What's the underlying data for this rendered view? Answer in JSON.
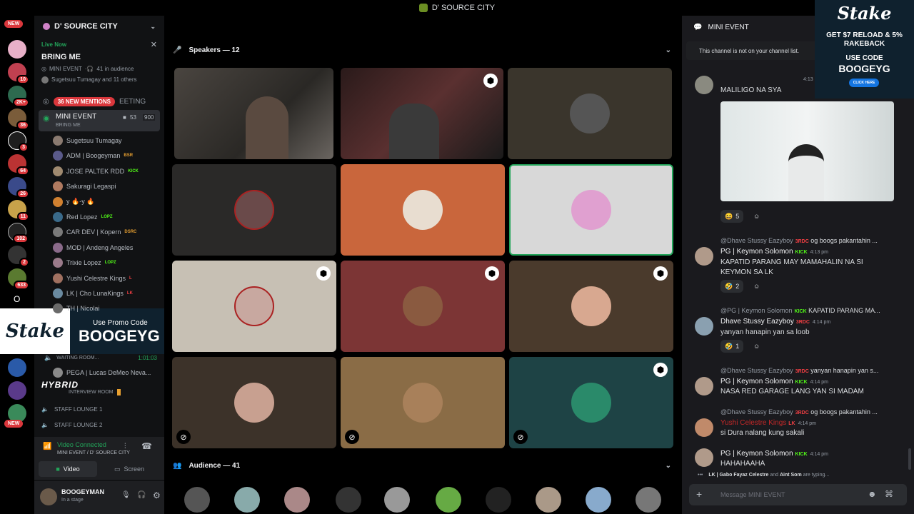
{
  "window": {
    "title": "D' SOURCE CITY"
  },
  "server_rail": {
    "new_top": "NEW",
    "new_bottom": "NEW",
    "badges": [
      "10",
      "2K+",
      "36",
      "3",
      "64",
      "26",
      "11",
      "102",
      "2",
      "633"
    ],
    "letter_o": "O"
  },
  "sidebar": {
    "server_name": "D' SOURCE CITY",
    "live": {
      "label": "Live Now",
      "title": "BRING ME",
      "meta1": "MINI EVENT",
      "meta2": "41 in audience",
      "meta3": "Sugetsuu Tumagay and 11 others"
    },
    "mentions": "36 NEW MENTIONS",
    "hidden_channel": "EETING",
    "active_channel": {
      "name": "MINI EVENT",
      "subtitle": "BRING ME",
      "count1": "53",
      "count2": "900"
    },
    "users": [
      {
        "name": "Sugetsuu Tumagay",
        "tag": ""
      },
      {
        "name": "ADM | Boogeyman",
        "tag": "BSR"
      },
      {
        "name": "JOSE PALTEK RDD",
        "tag": "KICK"
      },
      {
        "name": "Sakuragi Legaspi",
        "tag": ""
      },
      {
        "name": "y 🔥-y 🔥",
        "tag": ""
      },
      {
        "name": "Red Lopez",
        "tag": "LOPZ"
      },
      {
        "name": "CAR DEV | Kopern",
        "tag": "DSRC"
      },
      {
        "name": "MOD | Andeng Angeles",
        "tag": ""
      },
      {
        "name": "Trixie Lopez",
        "tag": "LOPZ"
      },
      {
        "name": "Yushi Celestre Kings",
        "tag": "L"
      },
      {
        "name": "LK | Cho LunaKings",
        "tag": "LK"
      },
      {
        "name": "TH | Nicolai",
        "tag": ""
      }
    ],
    "waiting_room": "WAITING ROOM...",
    "waiting_time": "1:01:03",
    "pega_user": "PEGA | Lucas DeMeo Neva...",
    "interview_room": "INTERVIEW ROOM",
    "staff1": "STAFF LOUNGE 1",
    "staff2": "STAFF LOUNGE 2",
    "voice": {
      "status": "Video Connected",
      "location": "MINI EVENT / D' SOURCE CITY",
      "video_btn": "Video",
      "screen_btn": "Screen"
    },
    "user": {
      "name": "BOOGEYMAN",
      "status": "In a stage"
    }
  },
  "overlay": {
    "brand": "Stake",
    "promo_label": "Use Promo Code",
    "promo_code": "BOOGEYG",
    "hybrid": "HYBRID"
  },
  "stage": {
    "speakers_label": "Speakers — 12",
    "audience_label": "Audience — 41"
  },
  "chat": {
    "channel": "MINI EVENT",
    "notice": "This channel is not on your channel list.",
    "messages": [
      {
        "time": "4:13 pm",
        "text": "MALILIGO NA SYA",
        "reaction_count": "5"
      },
      {
        "reply": "@Dhave Stussy Eazyboy",
        "reply_tag": "3RDC",
        "reply_text": "og boogs pakantahin ...",
        "name": "PG | Keymon Solomon",
        "tag": "KICK",
        "time": "4:13 pm",
        "text1": "KAPATID PARANG MAY MAMAHALIN NA SI",
        "text2": "KEYMON SA LK",
        "reaction_count": "2"
      },
      {
        "reply": "@PG | Keymon Solomon",
        "reply_tag": "KICK",
        "reply_text": "KAPATID PARANG MA...",
        "name": "Dhave Stussy Eazyboy",
        "tag": "3RDC",
        "time": "4:14 pm",
        "text": "yanyan hanapin yan sa loob",
        "reaction_count": "1"
      },
      {
        "reply": "@Dhave Stussy Eazyboy",
        "reply_tag": "3RDC",
        "reply_text": "yanyan hanapin yan s...",
        "name": "PG | Keymon Solomon",
        "tag": "KICK",
        "time": "4:14 pm",
        "text": "NASA RED GARAGE LANG YAN SI MADAM"
      },
      {
        "reply": "@Dhave Stussy Eazyboy",
        "reply_tag": "3RDC",
        "reply_text": "og boogs pakantahin ...",
        "name": "Yushi Celestre Kings",
        "tag": "LK",
        "time": "4:14 pm",
        "text": "si Dura nalang kung sakali"
      },
      {
        "name": "PG | Keymon Solomon",
        "tag": "KICK",
        "time": "4:14 pm",
        "text": "HAHAHAAHA"
      }
    ],
    "typing_users": "LK | Gabo Fayaz Celestre",
    "typing_and": "and",
    "typing_user2": "Aint Som",
    "typing_suffix": "are typing...",
    "input_placeholder": "Message MINI EVENT"
  },
  "ad": {
    "brand": "Stake",
    "line1": "GET $7 RELOAD & 5%",
    "line2": "RAKEBACK",
    "line3": "USE CODE",
    "code": "BOOGEYG",
    "cta": "CLICK HERE"
  }
}
